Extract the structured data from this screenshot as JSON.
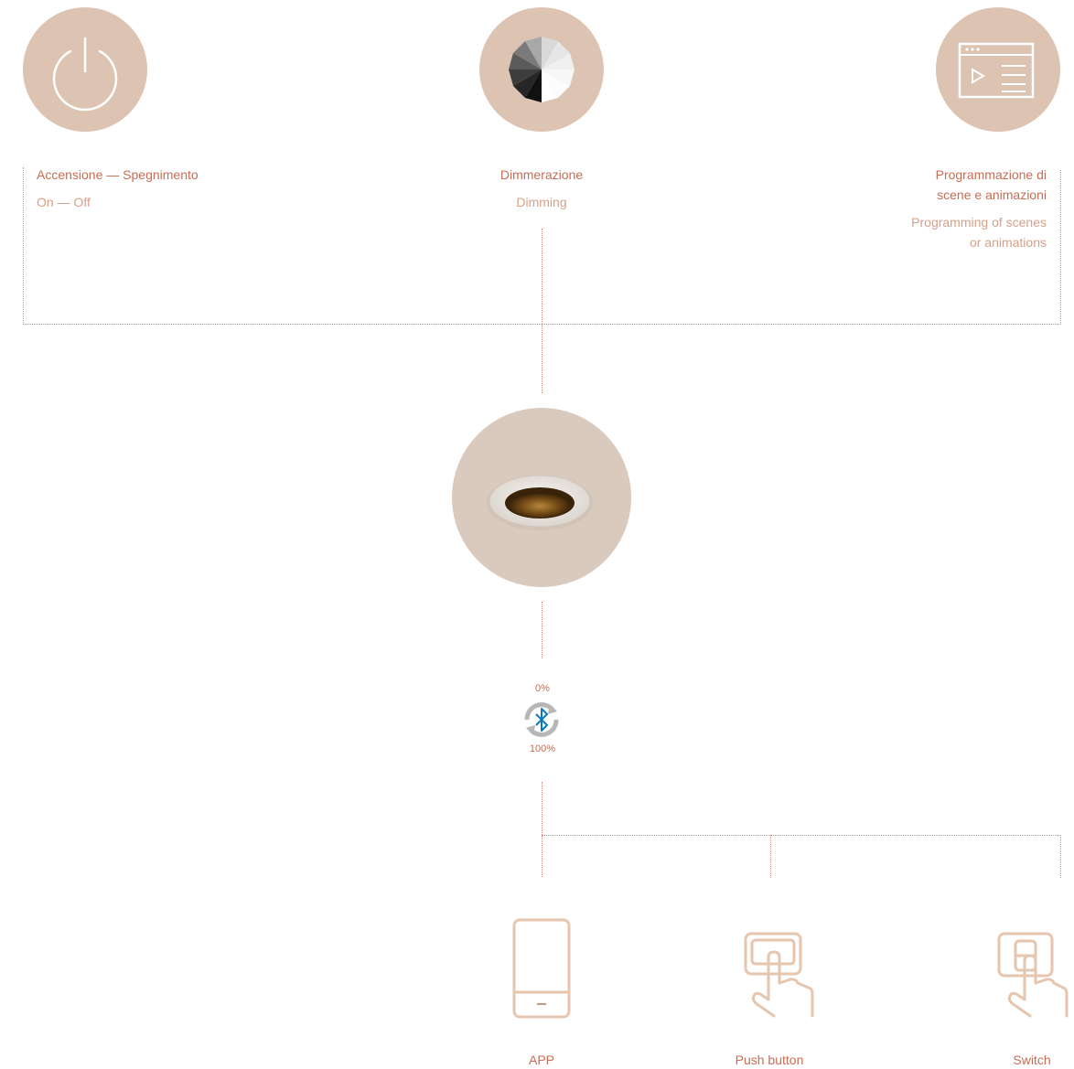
{
  "functions": [
    {
      "title": "Accensione — Spegnimento",
      "subtitle": "On — Off",
      "icon": "power-icon"
    },
    {
      "title": "Dimmerazione",
      "subtitle": "Dimming",
      "icon": "dimming-wheel-icon"
    },
    {
      "title_line1": "Programmazione di",
      "title_line2": "scene e animazioni",
      "subtitle_line1": "Programming of scenes",
      "subtitle_line2": "or animations",
      "icon": "browser-play-icon"
    }
  ],
  "product": {
    "icon": "downlight-product"
  },
  "bluetooth": {
    "top_label": "0%",
    "bottom_label": "100%",
    "icon": "bluetooth-icon"
  },
  "controls": [
    {
      "label": "APP",
      "icon": "smartphone-icon"
    },
    {
      "label": "Push button",
      "icon": "push-button-icon"
    },
    {
      "label": "Switch",
      "icon": "switch-icon"
    }
  ],
  "colors": {
    "circle": "#dcc3b2",
    "accent": "#c76d55",
    "line": "#dd8a7b",
    "icon_stroke": "#e6c6ae"
  }
}
